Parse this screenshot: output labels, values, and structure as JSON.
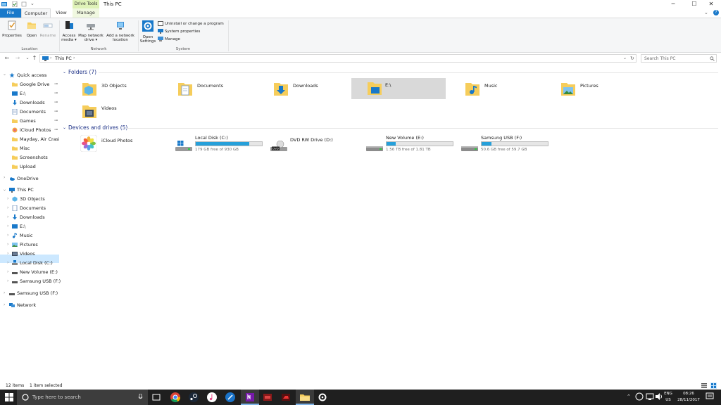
{
  "window": {
    "title": "This PC",
    "context_tab": "Drive Tools",
    "controls": {
      "minimize": "─",
      "maximize": "☐",
      "close": "✕"
    },
    "expand_ribbon": "⌄",
    "help": "?"
  },
  "ribbon_tabs": {
    "file": "File",
    "computer": "Computer",
    "view": "View",
    "manage": "Manage"
  },
  "ribbon": {
    "location_group": {
      "label": "Location",
      "buttons": {
        "properties": "Properties",
        "open": "Open",
        "rename": "Rename"
      }
    },
    "network_group": {
      "label": "Network",
      "buttons": {
        "access_media_1": "Access",
        "access_media_2": "media ▾",
        "map_drive_1": "Map network",
        "map_drive_2": "drive ▾",
        "add_location_1": "Add a network",
        "add_location_2": "location"
      }
    },
    "system_group": {
      "label": "System",
      "open_settings_1": "Open",
      "open_settings_2": "Settings",
      "uninstall": "Uninstall or change a program",
      "system_properties": "System properties",
      "manage": "Manage"
    }
  },
  "address": {
    "back": "←",
    "forward": "→",
    "down": "⌄",
    "up": "↑",
    "breadcrumb": "This PC",
    "sep1": "›",
    "sep2": "›",
    "dropdown": "⌄",
    "refresh": "↻",
    "search_placeholder": "Search This PC"
  },
  "nav": {
    "quick_access": "Quick access",
    "quick_items": [
      "Google Drive",
      "E:\\",
      "Downloads",
      "Documents",
      "Games",
      "iCloud Photos",
      "Mayday, Air Crash I",
      "Misc",
      "Screenshots",
      "Upload"
    ],
    "pin": "📌",
    "onedrive": "OneDrive",
    "this_pc": "This PC",
    "pc_items": [
      "3D Objects",
      "Documents",
      "Downloads",
      "E:\\",
      "Music",
      "Pictures",
      "Videos",
      "Local Disk (C:)",
      "New Volume (E:)",
      "Samsung USB (F:)"
    ],
    "samsung_usb": "Samsung USB (F:)",
    "network": "Network"
  },
  "content": {
    "folders_header": "Folders (7)",
    "folders": [
      "3D Objects",
      "Documents",
      "Downloads",
      "E:\\",
      "Music",
      "Pictures",
      "Videos"
    ],
    "drives_header": "Devices and drives (5)",
    "devices": {
      "icloud": "iCloud Photos",
      "c": {
        "name": "Local Disk (C:)",
        "free": "179 GB free of 930 GB",
        "used_fraction": 0.81
      },
      "dvd": {
        "name": "DVD RW Drive (D:)",
        "label": "DVD"
      },
      "e": {
        "name": "New Volume (E:)",
        "free": "1.56 TB free of 1.81 TB",
        "used_fraction": 0.14
      },
      "f": {
        "name": "Samsung USB (F:)",
        "free": "50.6 GB free of 59.7 GB",
        "used_fraction": 0.15
      }
    }
  },
  "status": {
    "items": "12 items",
    "selected": "1 item selected"
  },
  "taskbar": {
    "search_placeholder": "Type here to search",
    "lang": "ENG",
    "region": "US",
    "time": "08:26",
    "date": "28/11/2017"
  },
  "colors": {
    "accent": "#1979ca",
    "selected": "#cce8ff",
    "drive_fill": "#26a0da",
    "folder": "#f6cd5b",
    "taskbar": "#1f1f1f"
  }
}
